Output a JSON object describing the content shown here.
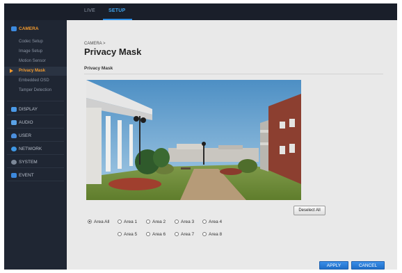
{
  "topbar": {
    "tabs": [
      {
        "label": "LIVE"
      },
      {
        "label": "SETUP"
      }
    ]
  },
  "sidebar": {
    "camera": {
      "label": "CAMERA",
      "icon": "camera-icon"
    },
    "camera_items": [
      {
        "label": "Codec Setup"
      },
      {
        "label": "Image Setup"
      },
      {
        "label": "Motion Sensor"
      },
      {
        "label": "Privacy Mask"
      },
      {
        "label": "Embedded OSD"
      },
      {
        "label": "Tamper Detection"
      }
    ],
    "sections": [
      {
        "label": "DISPLAY",
        "icon": "monitor-icon"
      },
      {
        "label": "AUDIO",
        "icon": "speaker-icon"
      },
      {
        "label": "USER",
        "icon": "user-icon"
      },
      {
        "label": "NETWORK",
        "icon": "globe-icon"
      },
      {
        "label": "SYSTEM",
        "icon": "gear-icon"
      },
      {
        "label": "EVENT",
        "icon": "bell-icon"
      }
    ],
    "active_item": "Privacy Mask",
    "accent": "#f29a2e"
  },
  "main": {
    "breadcrumb": "CAMERA >",
    "title": "Privacy Mask",
    "section_title": "Privacy Mask",
    "deselect_label": "Deselect All",
    "areas": [
      {
        "label": "Area All",
        "checked": true
      },
      {
        "label": "Area 1",
        "checked": false
      },
      {
        "label": "Area 2",
        "checked": false
      },
      {
        "label": "Area 3",
        "checked": false
      },
      {
        "label": "Area 4",
        "checked": false
      },
      {
        "label": "Area 5",
        "checked": false
      },
      {
        "label": "Area 6",
        "checked": false
      },
      {
        "label": "Area 7",
        "checked": false
      },
      {
        "label": "Area 8",
        "checked": false
      }
    ],
    "apply_label": "APPLY",
    "cancel_label": "CANCEL",
    "button_color": "#2c7fdc"
  }
}
